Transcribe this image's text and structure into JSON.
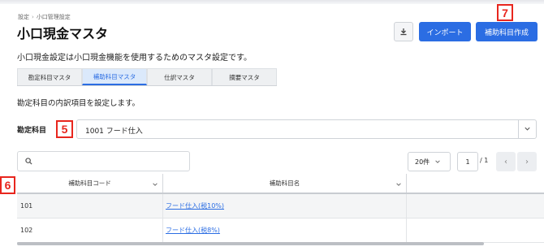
{
  "breadcrumb": [
    "設定",
    "小口管理設定"
  ],
  "page_title": "小口現金マスタ",
  "toolbar": {
    "download_icon": "download-icon",
    "import_label": "インポート",
    "create_label": "補助科目作成"
  },
  "markers": {
    "m7": "7",
    "m5": "5",
    "m6": "6"
  },
  "description": "小口現金設定は小口現金機能を使用するためのマスタ設定です。",
  "tabs": [
    {
      "label": "勘定科目マスタ",
      "active": false
    },
    {
      "label": "補助科目マスタ",
      "active": true
    },
    {
      "label": "仕訳マスタ",
      "active": false
    },
    {
      "label": "摘要マスタ",
      "active": false
    }
  ],
  "section_text": "勘定科目の内訳項目を設定します。",
  "account_field": {
    "label": "勘定科目",
    "value": "1001 フード仕入"
  },
  "search": {
    "placeholder": "",
    "value": ""
  },
  "pagination": {
    "per_page": "20件",
    "page": "1",
    "total": "/ 1"
  },
  "table": {
    "headers": [
      "補助科目コード",
      "補助科目名"
    ],
    "rows": [
      {
        "code": "101",
        "name": "フード仕入(税10%)"
      },
      {
        "code": "102",
        "name": "フード仕入(税8%)"
      }
    ]
  },
  "colors": {
    "accent": "#2b6de3",
    "marker": "#e8261e"
  }
}
